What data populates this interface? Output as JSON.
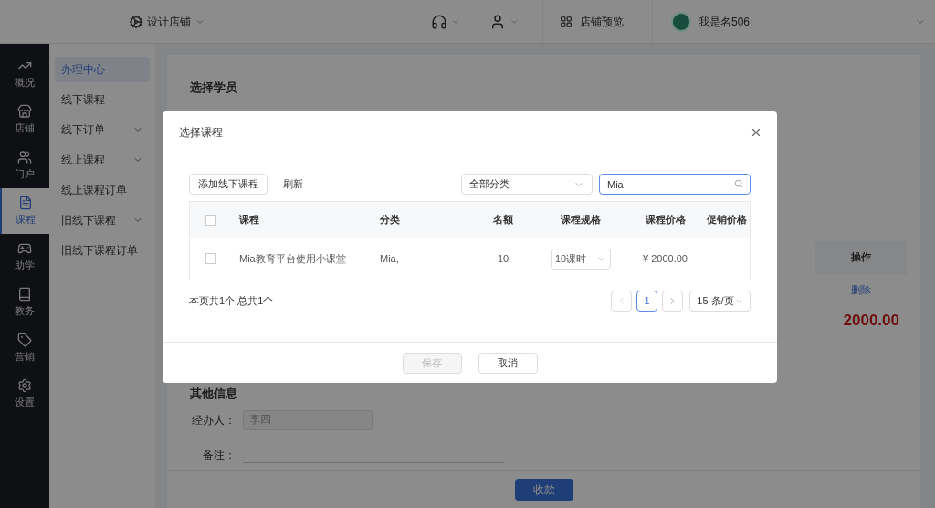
{
  "top_bar": {
    "design_store": "设计店铺",
    "store_preview": "店铺预览",
    "user_name": "我是名506"
  },
  "nav": [
    {
      "label": "概况",
      "selected": false
    },
    {
      "label": "店铺",
      "selected": false
    },
    {
      "label": "门户",
      "selected": false
    },
    {
      "label": "课程",
      "selected": true
    },
    {
      "label": "助学",
      "selected": false
    },
    {
      "label": "教务",
      "selected": false
    },
    {
      "label": "营销",
      "selected": false
    },
    {
      "label": "设置",
      "selected": false
    }
  ],
  "submenu": [
    {
      "label": "办理中心",
      "selected": true,
      "expandable": false
    },
    {
      "label": "线下课程",
      "selected": false,
      "expandable": false
    },
    {
      "label": "线下订单",
      "selected": false,
      "expandable": true
    },
    {
      "label": "线上课程",
      "selected": false,
      "expandable": true
    },
    {
      "label": "线上课程订单",
      "selected": false,
      "expandable": false
    },
    {
      "label": "旧线下课程",
      "selected": false,
      "expandable": true
    },
    {
      "label": "旧线下课程订单",
      "selected": false,
      "expandable": false
    }
  ],
  "page": {
    "section_title": "选择学员",
    "operation_header": "操作",
    "delete_link": "删除",
    "total": "2000.00",
    "other_title": "其他信息",
    "handler_label": "经办人：",
    "handler_value": "李四",
    "remark_label": "备注：",
    "collect_button": "收款"
  },
  "dialog": {
    "title": "选择课程",
    "add_button": "添加线下课程",
    "refresh": "刷新",
    "category_select": "全部分类",
    "search_value": "Mia",
    "columns": [
      "课程",
      "分类",
      "名额",
      "课程规格",
      "课程价格",
      "促销价格"
    ],
    "select_all_checked": false,
    "rows": [
      {
        "checked": false,
        "course": "Mia教育平台使用小课堂",
        "category": "Mia,",
        "quota": "10",
        "spec": "10课时",
        "price": "¥ 2000.00"
      }
    ],
    "summary": "本页共1个 总共1个",
    "page": "1",
    "page_size": "15 条/页",
    "save": "保存",
    "save_disabled": true,
    "cancel": "取消"
  }
}
